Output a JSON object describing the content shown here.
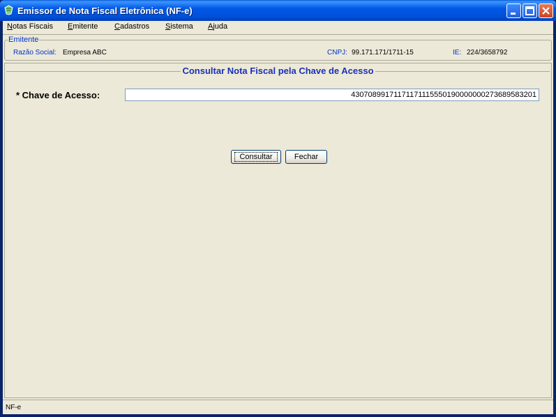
{
  "window": {
    "title": "Emissor de Nota Fiscal Eletrônica (NF-e)"
  },
  "menu": [
    {
      "label": "Notas Fiscais",
      "mnemonic": "N",
      "rest": "otas Fiscais"
    },
    {
      "label": "Emitente",
      "mnemonic": "E",
      "rest": "mitente"
    },
    {
      "label": "Cadastros",
      "mnemonic": "C",
      "rest": "adastros"
    },
    {
      "label": "Sistema",
      "mnemonic": "S",
      "rest": "istema"
    },
    {
      "label": "Ajuda",
      "mnemonic": "A",
      "rest": "juda"
    }
  ],
  "emitente": {
    "legend": "Emitente",
    "razao_label": "Razão Social:",
    "razao_value": "Empresa ABC",
    "cnpj_label": "CNPJ:",
    "cnpj_value": "99.171.171/1711-15",
    "ie_label": "IE:",
    "ie_value": "224/3658792"
  },
  "form": {
    "title": "Consultar Nota Fiscal pela Chave de Acesso",
    "chave_label": "* Chave de Acesso:",
    "chave_value": "43070899171171171115550190000000273689583201"
  },
  "buttons": {
    "consultar": "Consultar",
    "fechar": "Fechar"
  },
  "status": {
    "text": "NF-e"
  },
  "colors": {
    "title_bar": "#0058E6",
    "label_blue": "#0033CC",
    "panel_title": "#1C2FB8",
    "background": "#ECE9D8"
  }
}
